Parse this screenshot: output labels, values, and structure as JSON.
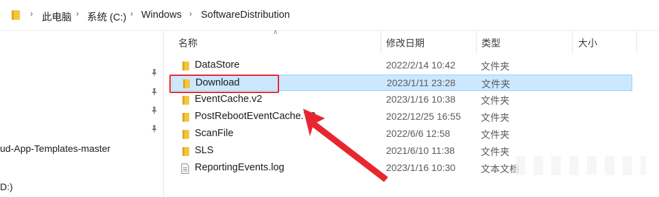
{
  "address_bar": {
    "crumbs": [
      "此电脑",
      "系统 (C:)",
      "Windows",
      "SoftwareDistribution"
    ]
  },
  "nav": {
    "items": [
      {
        "label": "ud-App-Templates-master"
      },
      {
        "label": "D:)"
      }
    ]
  },
  "columns": {
    "name": "名称",
    "date": "修改日期",
    "type": "类型",
    "size": "大小"
  },
  "files": [
    {
      "name": "DataStore",
      "date": "2022/2/14 10:42",
      "type": "文件夹",
      "icon": "folder-icon",
      "selected": false
    },
    {
      "name": "Download",
      "date": "2023/1/11 23:28",
      "type": "文件夹",
      "icon": "folder-icon",
      "selected": true
    },
    {
      "name": "EventCache.v2",
      "date": "2023/1/16 10:38",
      "type": "文件夹",
      "icon": "folder-icon",
      "selected": false
    },
    {
      "name": "PostRebootEventCache.V2",
      "date": "2022/12/25 16:55",
      "type": "文件夹",
      "icon": "folder-icon",
      "selected": false
    },
    {
      "name": "ScanFile",
      "date": "2022/6/6 12:58",
      "type": "文件夹",
      "icon": "folder-icon",
      "selected": false
    },
    {
      "name": "SLS",
      "date": "2021/6/10 11:38",
      "type": "文件夹",
      "icon": "folder-icon",
      "selected": false
    },
    {
      "name": "ReportingEvents.log",
      "date": "2023/1/16 10:30",
      "type": "文本文档",
      "icon": "text-file-icon",
      "selected": false
    }
  ],
  "colors": {
    "selection_bg": "#cce8ff",
    "selection_border": "#99d1ff",
    "annotation_red": "#e8262f",
    "folder_yellow": "#f4c542"
  }
}
